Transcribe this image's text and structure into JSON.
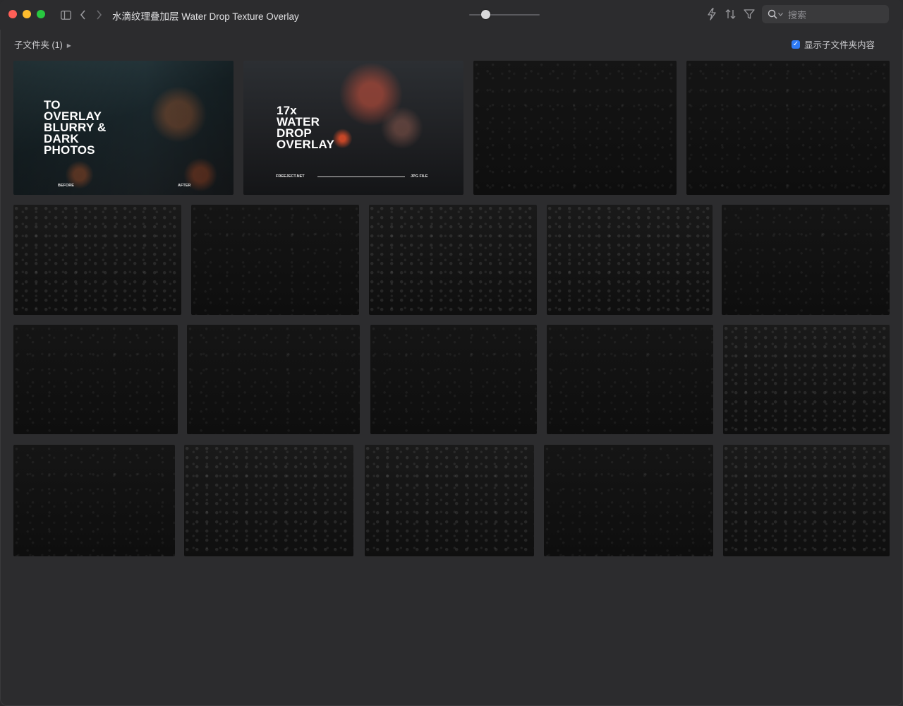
{
  "window": {
    "title": "水滴纹理叠加层 Water Drop Texture Overlay",
    "icons": [
      "sidebar-toggle-icon",
      "chevron-left-icon",
      "chevron-right-icon",
      "lightning-icon",
      "sort-icon",
      "filter-icon",
      "search-icon"
    ],
    "zoom_slider_fraction": 0.2
  },
  "search": {
    "placeholder": "搜索"
  },
  "subheader": {
    "subfolder_label": "子文件夹 (1)",
    "show_subfolder_label": "显示子文件夹内容",
    "show_subfolder_checked": true
  },
  "covers": {
    "cover1": {
      "lines": [
        "TO",
        "OVERLAY",
        "BLURRY &",
        "DARK",
        "PHOTOS"
      ],
      "before": "BEFORE",
      "after": "AFTER"
    },
    "cover2": {
      "lines": [
        "17x",
        "WATER",
        "DROP",
        "OVERLAY"
      ],
      "site": "FREEJECT.NET",
      "filetype": "JPG FILE"
    }
  },
  "colors": {
    "close": "#ff5f57",
    "minimize": "#febc2e",
    "maximize": "#28c840",
    "accent": "#2f7bf5",
    "background": "#2c2c2e"
  }
}
